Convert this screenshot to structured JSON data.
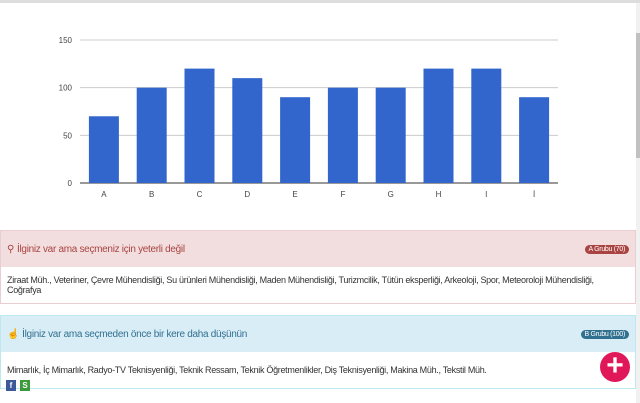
{
  "chart_data": {
    "type": "bar",
    "categories": [
      "A",
      "B",
      "C",
      "D",
      "E",
      "F",
      "G",
      "H",
      "I",
      "İ"
    ],
    "values": [
      70,
      100,
      120,
      110,
      90,
      100,
      100,
      120,
      120,
      90
    ],
    "yticks": [
      0,
      50,
      100,
      150
    ],
    "ylim": [
      0,
      150
    ],
    "color": "#3366cc"
  },
  "panels": [
    {
      "title": "İlginiz var ama seçmeniz için yeterli değil",
      "badge": "A Grubu (70)",
      "body": "Ziraat Müh., Veteriner, Çevre Mühendisliği, Su ürünleri Mühendisliği, Maden Mühendisliği, Turizmcilik, Tütün eksperliği, Arkeoloji, Spor, Meteoroloji Mühendisliği, Coğrafya"
    },
    {
      "title": "İlginiz var ama seçmeden önce bir kere daha düşünün",
      "badge": "B Grubu (100)",
      "body": "Mimarlık, İç Mimarlık, Radyo-TV Teknisyenliği, Teknik Ressam, Teknik Öğretmenlikler, Diş Teknisyenliği, Makina Müh., Tekstil Müh."
    }
  ],
  "fab": "+",
  "share": {
    "facebook": "f",
    "other": "S"
  }
}
